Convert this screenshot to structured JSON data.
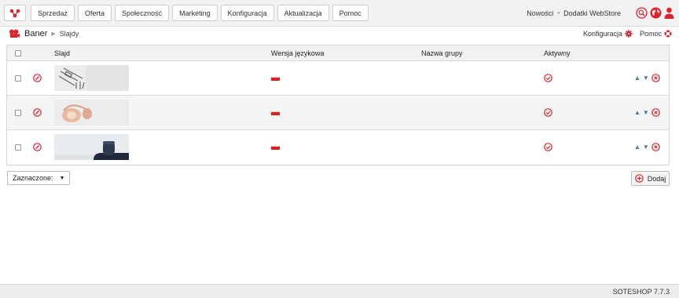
{
  "nav": {
    "items": [
      "Sprzedaż",
      "Oferta",
      "Społeczność",
      "Marketing",
      "Konfiguracja",
      "Aktualizacja",
      "Pomoc"
    ],
    "right_links": [
      "Nowości",
      "Dodatki WebStore"
    ],
    "separator": "•"
  },
  "breadcrumb": {
    "title": "Baner",
    "sub": "Slajdy",
    "config_label": "Konfiguracja",
    "help_label": "Pomoc"
  },
  "table": {
    "headers": [
      "Slajd",
      "Wersja językowa",
      "Nazwa grupy",
      "Aktywny"
    ],
    "rows": [
      {
        "image": "slide-image-cables",
        "language": "pl-flag",
        "group": "",
        "active": true
      },
      {
        "image": "slide-image-headphones",
        "language": "pl-flag",
        "group": "",
        "active": true
      },
      {
        "image": "slide-image-speaker",
        "language": "pl-flag",
        "group": "",
        "active": true
      }
    ]
  },
  "bulk": {
    "label": "Zaznaczone:"
  },
  "add_button": {
    "label": "Dodaj"
  },
  "footer": {
    "version": "SOTESHOP 7.7.3"
  },
  "colors": {
    "accent": "#d9232d",
    "arrow": "#4a6fa5",
    "flag": "#e02020"
  }
}
